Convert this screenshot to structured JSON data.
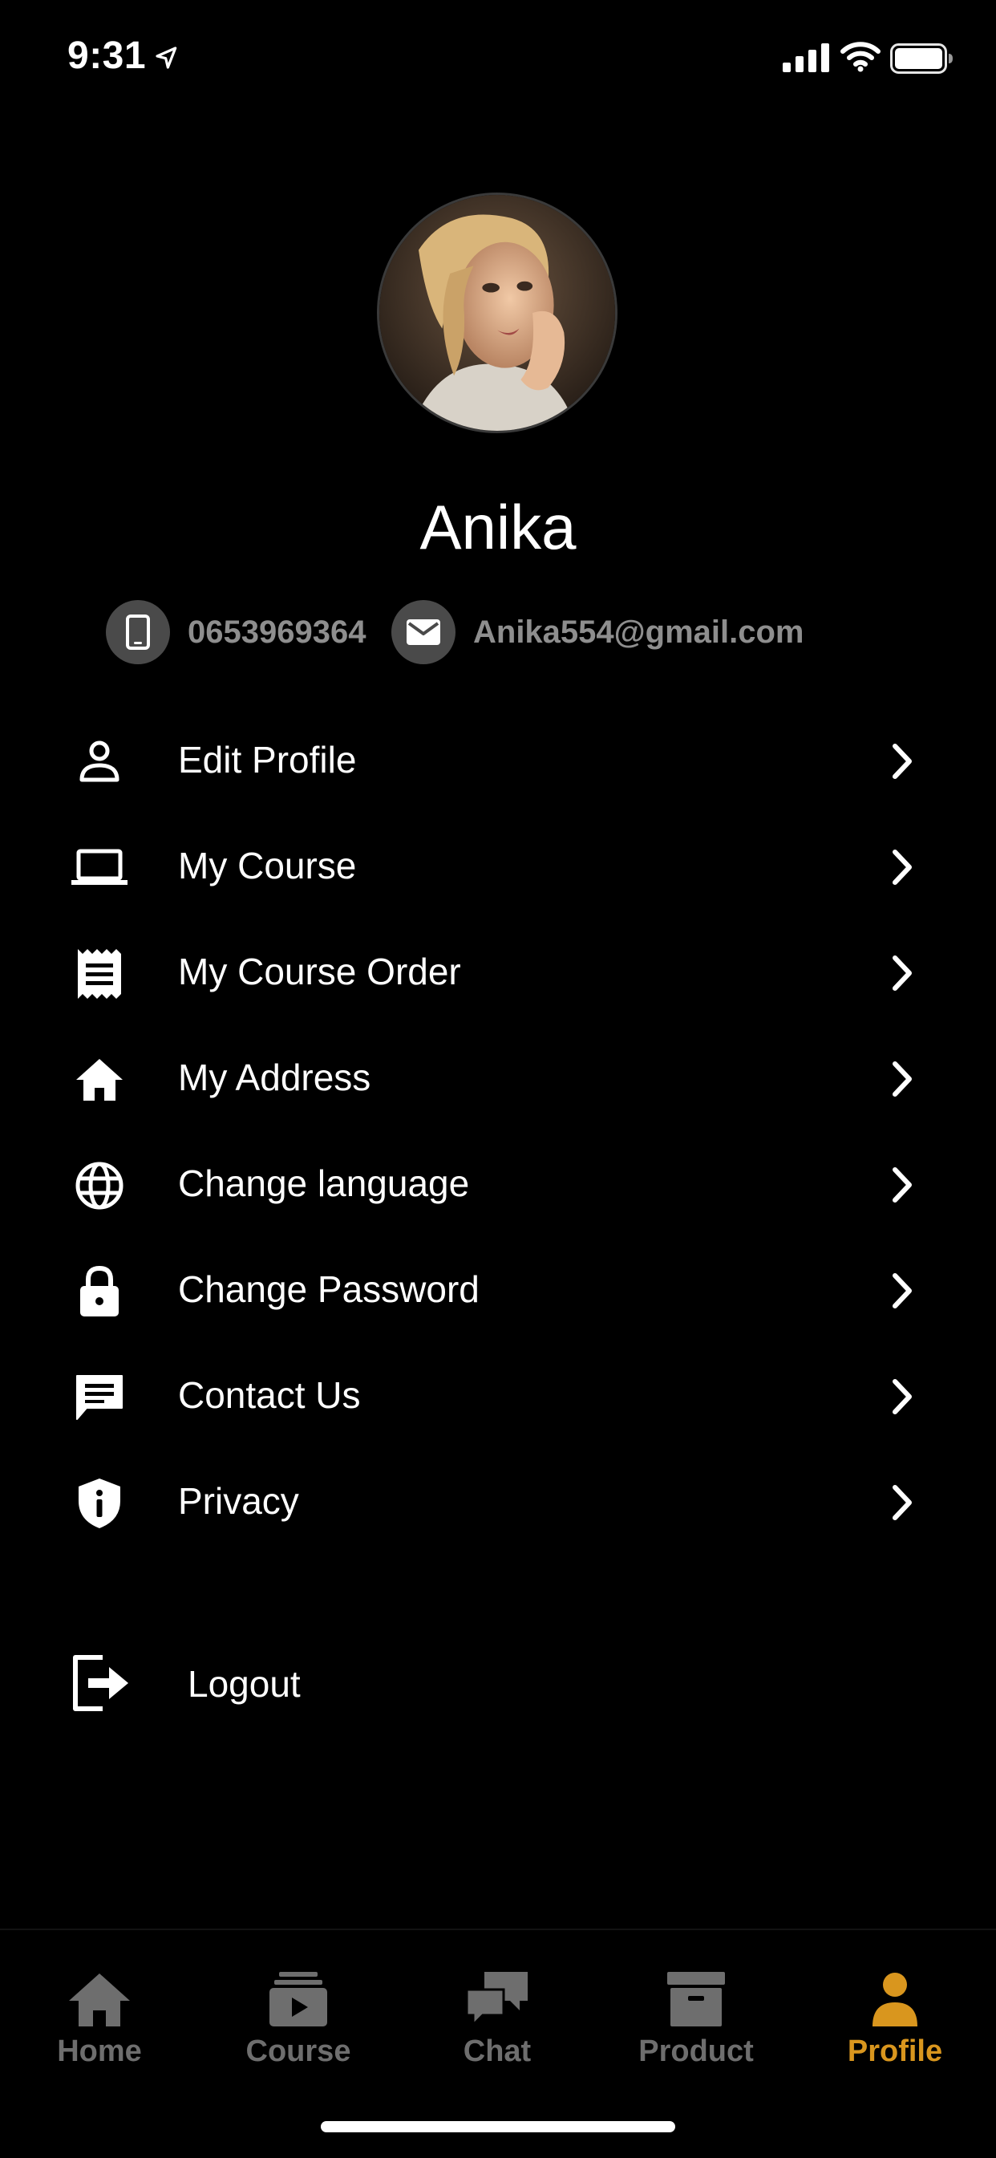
{
  "status_bar": {
    "time": "9:31",
    "icons": [
      "location-arrow-icon",
      "cellular-signal-icon",
      "wifi-icon",
      "battery-icon"
    ]
  },
  "profile": {
    "name": "Anika",
    "phone": "0653969364",
    "email": "Anika554@gmail.com",
    "avatar_alt": "profile photo"
  },
  "menu": {
    "items": [
      {
        "label": "Edit Profile",
        "icon": "person-icon"
      },
      {
        "label": "My Course",
        "icon": "laptop-icon"
      },
      {
        "label": "My Course Order",
        "icon": "receipt-icon"
      },
      {
        "label": "My Address",
        "icon": "home-icon"
      },
      {
        "label": "Change language",
        "icon": "globe-icon"
      },
      {
        "label": "Change Password",
        "icon": "lock-icon"
      },
      {
        "label": "Contact Us",
        "icon": "chat-icon"
      },
      {
        "label": "Privacy",
        "icon": "shield-info-icon"
      }
    ],
    "chevron_icon": "chevron-right-icon"
  },
  "logout": {
    "label": "Logout",
    "icon": "logout-icon"
  },
  "tab_bar": {
    "tabs": [
      {
        "label": "Home",
        "icon": "home-icon",
        "active": false
      },
      {
        "label": "Course",
        "icon": "video-stack-icon",
        "active": false
      },
      {
        "label": "Chat",
        "icon": "chat-bubbles-icon",
        "active": false
      },
      {
        "label": "Product",
        "icon": "archive-box-icon",
        "active": false
      },
      {
        "label": "Profile",
        "icon": "person-icon",
        "active": true
      }
    ]
  },
  "colors": {
    "background": "#000000",
    "text": "#ffffff",
    "muted_text": "#8e8e8e",
    "contact_icon_bg": "#4a4a4a",
    "tab_inactive": "#6e6e6e",
    "tab_active": "#d9961e"
  }
}
